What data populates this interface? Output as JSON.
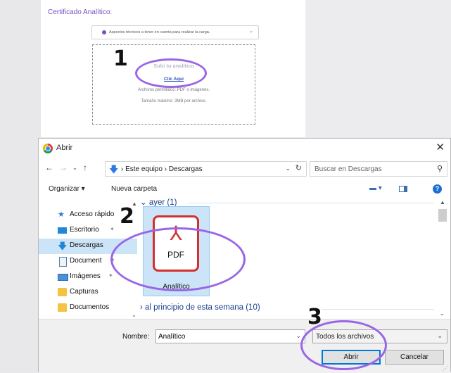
{
  "web": {
    "cert_title": "Certificado Analítico:",
    "aspectos": "Aspectos técnicos a tener en cuenta para realizar la carga.",
    "upload_title": "Subí tu analítico",
    "upload_link": "Clic Aquí",
    "permitidos": "Archivos permitidos: PDF o imágenes.",
    "tamano": "Tamaño máximo: 3MB por archivo."
  },
  "annotations": {
    "step1": "1",
    "step2": "2",
    "step3": "3",
    "accent_color": "#9a66e6"
  },
  "dialog": {
    "title": "Abrir",
    "close_glyph": "✕",
    "breadcrumb": "›  Este equipo  ›  Descargas",
    "search_placeholder": "Buscar en Descargas",
    "toolbar": {
      "organizar": "Organizar ▾",
      "nueva_carpeta": "Nueva carpeta"
    },
    "sidebar": [
      {
        "label": "Acceso rápido",
        "icon": "star-icon"
      },
      {
        "label": "Escritorio",
        "icon": "desktop-icon"
      },
      {
        "label": "Descargas",
        "icon": "download-icon"
      },
      {
        "label": "Document",
        "icon": "document-icon"
      },
      {
        "label": "Imágenes",
        "icon": "images-icon"
      },
      {
        "label": "Capturas",
        "icon": "folder-icon"
      },
      {
        "label": "Documentos",
        "icon": "folder-icon"
      }
    ],
    "groups": {
      "ayer": "ayer (1)",
      "principio": "al principio de esta semana (10)"
    },
    "file": {
      "type_label": "PDF",
      "name": "Analítico"
    },
    "bottom": {
      "nombre_label": "Nombre:",
      "nombre_value": "Analítico",
      "tipo_value": "Todos los archivos",
      "abrir": "Abrir",
      "cancelar": "Cancelar"
    }
  }
}
